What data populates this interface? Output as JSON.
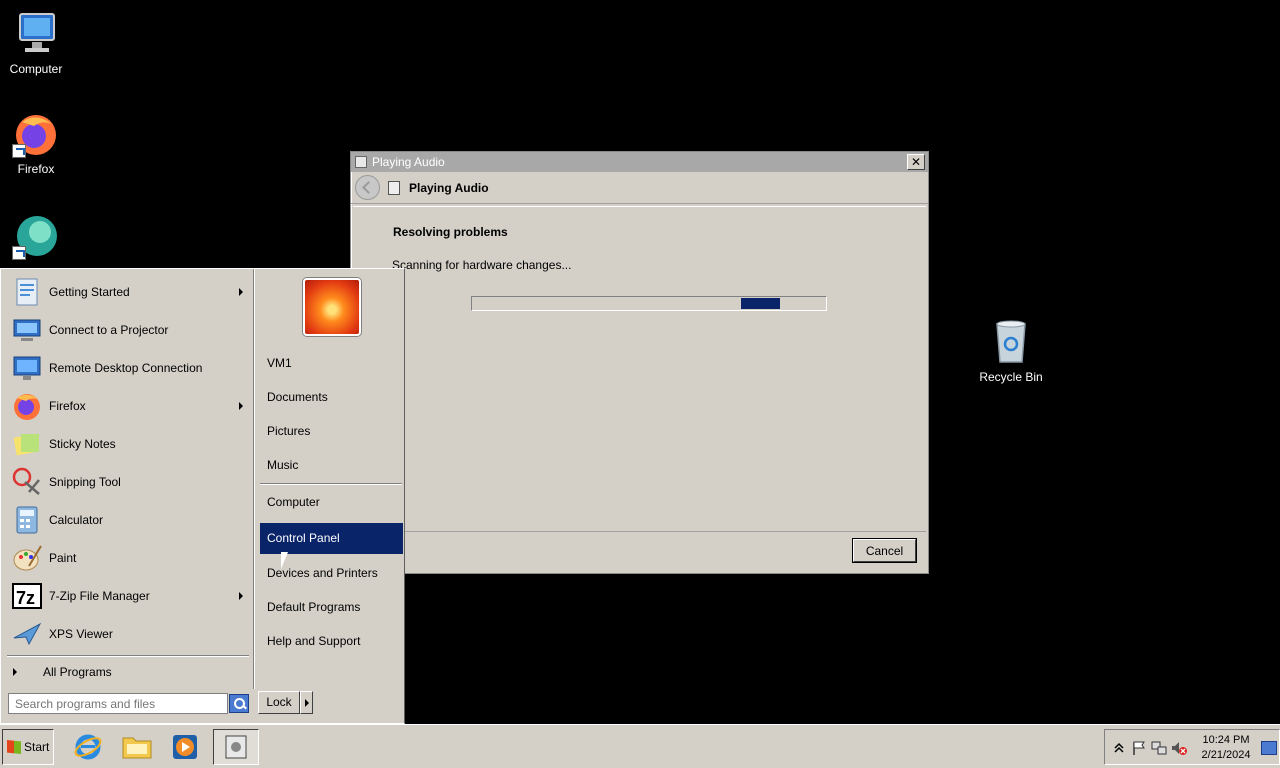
{
  "desktop": {
    "icons": [
      {
        "label": "Computer"
      },
      {
        "label": "Firefox"
      },
      {
        "label": "Recycle Bin"
      }
    ]
  },
  "dialog": {
    "title": "Playing Audio",
    "nav_title": "Playing Audio",
    "close_label": "✕",
    "heading": "Resolving problems",
    "status": "Scanning for hardware changes...",
    "progress_indeterminate_segment": {
      "start_fraction": 0.76,
      "end_fraction": 0.87
    },
    "cancel_label": "Cancel"
  },
  "start_menu": {
    "programs": [
      {
        "label": "Getting Started",
        "has_submenu": true
      },
      {
        "label": "Connect to a Projector",
        "has_submenu": false
      },
      {
        "label": "Remote Desktop Connection",
        "has_submenu": false
      },
      {
        "label": "Firefox",
        "has_submenu": true
      },
      {
        "label": "Sticky Notes",
        "has_submenu": false
      },
      {
        "label": "Snipping Tool",
        "has_submenu": false
      },
      {
        "label": "Calculator",
        "has_submenu": false
      },
      {
        "label": "Paint",
        "has_submenu": false
      },
      {
        "label": "7-Zip File Manager",
        "has_submenu": true
      },
      {
        "label": "XPS Viewer",
        "has_submenu": false
      }
    ],
    "all_programs": "All Programs",
    "right_items": [
      {
        "label": "VM1"
      },
      {
        "label": "Documents"
      },
      {
        "label": "Pictures"
      },
      {
        "label": "Music"
      },
      {
        "label": "Computer"
      },
      {
        "label": "Control Panel",
        "highlighted": true
      },
      {
        "label": "Devices and Printers"
      },
      {
        "label": "Default Programs"
      },
      {
        "label": "Help and Support"
      }
    ],
    "search_placeholder": "Search programs and files",
    "lock_label": "Lock"
  },
  "taskbar": {
    "start_label": "Start",
    "clock_time": "10:24 PM",
    "clock_date": "2/21/2024"
  },
  "colors": {
    "highlight": "#0a246a",
    "face": "#d4d0c8",
    "desktop": "#000000"
  }
}
